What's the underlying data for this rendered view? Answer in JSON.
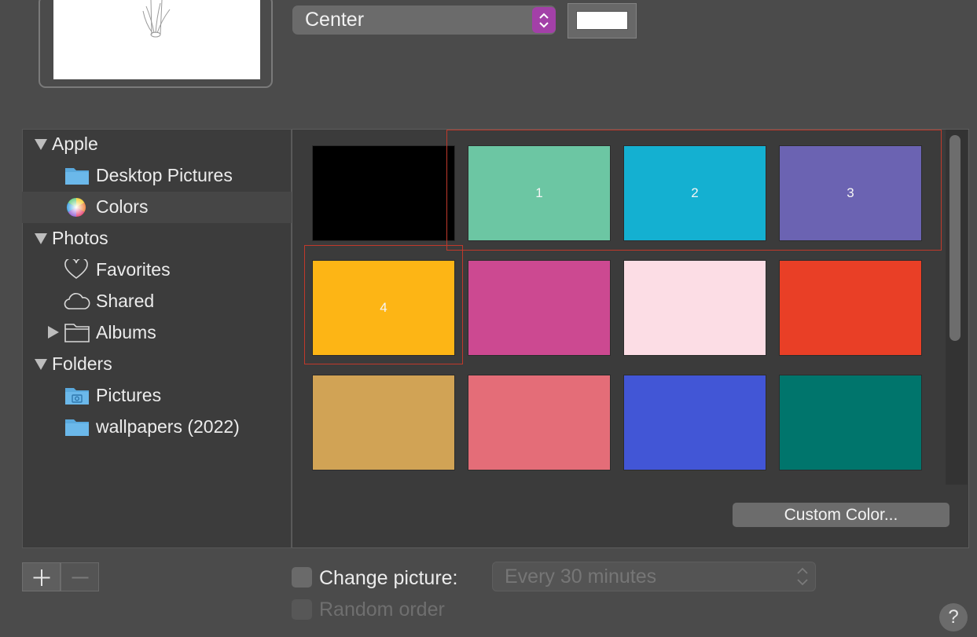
{
  "position": {
    "selected": "Center"
  },
  "sidebar": {
    "groups": [
      {
        "label": "Apple",
        "items": [
          {
            "label": "Desktop Pictures"
          },
          {
            "label": "Colors"
          }
        ]
      },
      {
        "label": "Photos",
        "items": [
          {
            "label": "Favorites"
          },
          {
            "label": "Shared"
          },
          {
            "label": "Albums"
          }
        ]
      },
      {
        "label": "Folders",
        "items": [
          {
            "label": "Pictures"
          },
          {
            "label": "wallpapers (2022)"
          }
        ]
      }
    ]
  },
  "swatches": [
    {
      "color": "#000000",
      "label": ""
    },
    {
      "color": "#6cc6a3",
      "label": "1"
    },
    {
      "color": "#14b0d1",
      "label": "2"
    },
    {
      "color": "#6b63b2",
      "label": "3"
    },
    {
      "color": "#fdb515",
      "label": "4"
    },
    {
      "color": "#cc4991",
      "label": ""
    },
    {
      "color": "#fcdde5",
      "label": ""
    },
    {
      "color": "#e93f26",
      "label": ""
    },
    {
      "color": "#d1a355",
      "label": ""
    },
    {
      "color": "#e46d78",
      "label": ""
    },
    {
      "color": "#4256d6",
      "label": ""
    },
    {
      "color": "#00756c",
      "label": ""
    }
  ],
  "custom_color_label": "Custom Color...",
  "change_picture_label": "Change picture:",
  "interval_value": "Every 30 minutes",
  "random_order_label": "Random order",
  "help_label": "?",
  "colors": {
    "accent": "#a340a8",
    "highlight": "#c0392b"
  }
}
